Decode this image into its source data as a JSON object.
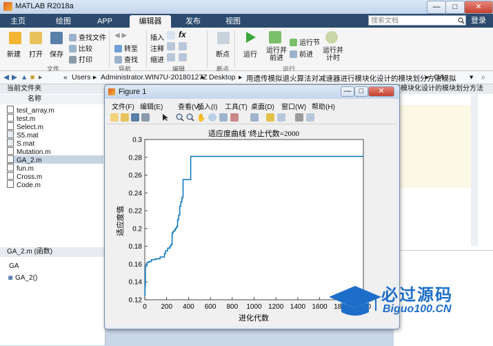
{
  "app": {
    "title": "MATLAB R2018a"
  },
  "window_controls": {
    "minimize": "—",
    "maximize": "□",
    "close": "✕"
  },
  "tabs": [
    "主页",
    "绘图",
    "APP",
    "编辑器",
    "发布",
    "视图"
  ],
  "search": {
    "placeholder": "搜索文档"
  },
  "login": "登录",
  "ribbon": {
    "new": "新建",
    "open": "打开",
    "save": "保存",
    "find_files": "查找文件",
    "compare": "比较",
    "print": "打印",
    "goto": "转至",
    "find": "查找",
    "insert": "插入",
    "comment": "注释",
    "indent": "缩进",
    "breakpoints": "断点",
    "run": "运行",
    "run_advance": [
      "运行并",
      "前进"
    ],
    "run_section": "运行节",
    "advance": "前进",
    "run_time": [
      "运行并",
      "计时"
    ],
    "groups": {
      "file": "文件",
      "navigate": "导航",
      "edit": "编辑",
      "breakpoints": "断点",
      "run": "运行"
    }
  },
  "address": {
    "path": [
      "Users",
      "Administrator.WIN7U-20180127Z",
      "Desktop",
      "用遗传模拟退火算法对减速器进行模块化设计的模块划分方法模拟",
      "GA"
    ]
  },
  "left_panel": {
    "header": "当前文件夹",
    "column": "名称",
    "files": [
      "test_array.m",
      "test.m",
      "Select.m",
      "S5.mat",
      "S.mat",
      "Mutation.m",
      "GA_2.m",
      "fun.m",
      "Cross.m",
      "Code.m"
    ],
    "selected": "GA_2.m",
    "detail_header": "GA_2.m  (函数)",
    "detail_name": "GA",
    "detail_item": "GA_2()"
  },
  "right_panel": {
    "header": "行模块化设计的模块划分方法"
  },
  "figure": {
    "title": "Figure 1",
    "menu": [
      "文件(F)",
      "编辑(E)",
      "查看(V)",
      "插入(I)",
      "工具(T)",
      "桌面(D)",
      "窗口(W)",
      "帮助(H)"
    ]
  },
  "chart_data": {
    "type": "line",
    "title": "适应度曲线  '终止代数=2000",
    "xlabel": "进化代数",
    "ylabel": "适应度值",
    "xlim": [
      0,
      2000
    ],
    "ylim": [
      0.12,
      0.3
    ],
    "xticks": [
      0,
      200,
      400,
      600,
      800,
      1000,
      1200,
      1400,
      1600,
      1800,
      2000
    ],
    "yticks": [
      0.12,
      0.14,
      0.16,
      0.18,
      0.2,
      0.22,
      0.24,
      0.26,
      0.28,
      0.3
    ],
    "color": "#0072bd",
    "series": [
      {
        "x": [
          0,
          2,
          5,
          20,
          40,
          60,
          80,
          100,
          140,
          180,
          190,
          210,
          230,
          240,
          250,
          260,
          270,
          280,
          290,
          300,
          310,
          320,
          330,
          340,
          350,
          400,
          420,
          2000
        ],
        "y": [
          0.125,
          0.135,
          0.158,
          0.162,
          0.163,
          0.165,
          0.165,
          0.166,
          0.168,
          0.172,
          0.175,
          0.178,
          0.18,
          0.182,
          0.195,
          0.197,
          0.198,
          0.2,
          0.202,
          0.21,
          0.215,
          0.225,
          0.23,
          0.235,
          0.255,
          0.255,
          0.281,
          0.281
        ]
      }
    ]
  },
  "watermark": {
    "main": "必过源码",
    "sub": "Biguo100.CN"
  }
}
